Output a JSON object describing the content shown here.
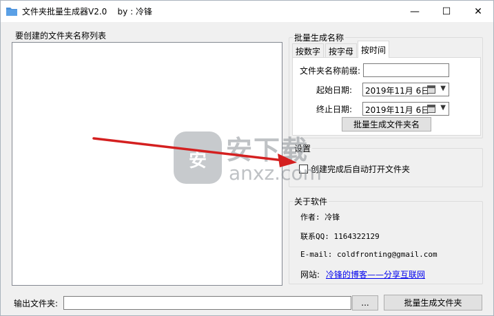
{
  "window": {
    "title": "文件夹批量生成器V2.0    by : 冷锋",
    "min_glyph": "—",
    "max_glyph": "☐",
    "close_glyph": "✕"
  },
  "left": {
    "list_label": "要创建的文件夹名称列表"
  },
  "batch": {
    "group_title": "批量生成名称",
    "tabs": [
      {
        "label": "按数字",
        "active": false
      },
      {
        "label": "按字母",
        "active": false
      },
      {
        "label": "按时间",
        "active": true
      }
    ],
    "prefix_label": "文件夹名称前缀:",
    "prefix_value": "",
    "start_label": "起始日期:",
    "start_value": "2019年11月 6日",
    "end_label": "终止日期:",
    "end_value": "2019年11月 6日",
    "generate_button": "批量生成文件夹名"
  },
  "settings": {
    "group_title": "设置",
    "auto_open_label": "创建完成后自动打开文件夹",
    "auto_open_checked": false
  },
  "about": {
    "group_title": "关于软件",
    "author": "作者: 冷锋",
    "qq": "联系QQ: 1164322129",
    "email": "E-mail: coldfronting@gmail.com",
    "site_label": "网站:",
    "site_link": "冷锋的博客——分享互联网"
  },
  "bottom": {
    "output_label": "输出文件夹:",
    "output_value": "",
    "browse_button": "...",
    "generate_button": "批量生成文件夹"
  },
  "watermark": {
    "icon_char": "安",
    "cn": "安下载",
    "en": "anxz.com"
  },
  "colors": {
    "arrow": "#d42020",
    "link": "#0000ee"
  },
  "icons": {
    "app": "folder-icon",
    "calendar": "calendar-icon",
    "dropdown": "chevron-down-icon"
  }
}
